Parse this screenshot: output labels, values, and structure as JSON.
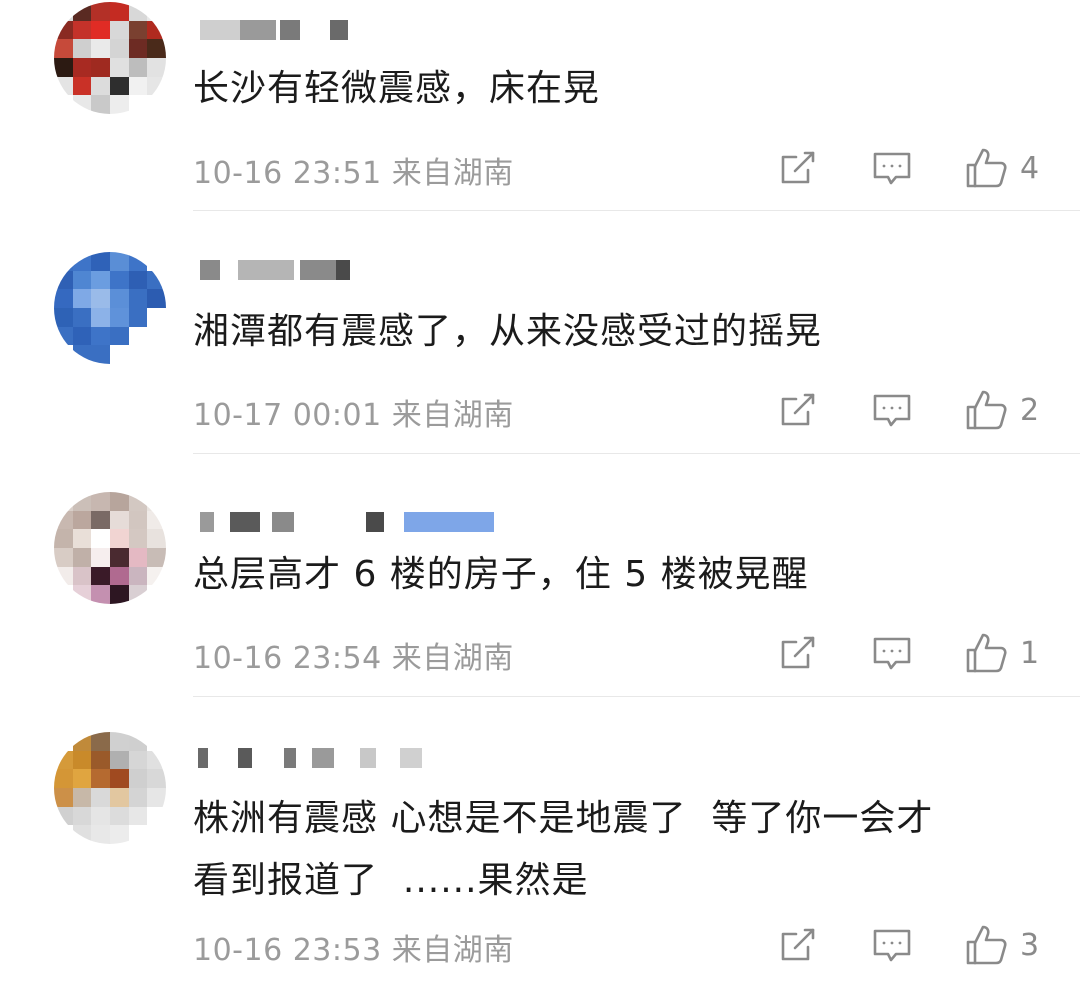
{
  "comments": [
    {
      "text_lines": [
        "长沙有轻微震感，床在晃"
      ],
      "time": "10-16 23:51",
      "location": "来自湖南",
      "likes": "4",
      "avatar_colors": [
        "#d9d9d9",
        "#5a2a22",
        "#b33027",
        "#c42b22",
        "#d8d8d8",
        "#e8e8e8",
        "#8a2a22",
        "#c4322a",
        "#e02c25",
        "#d8d8d8",
        "#7a4030",
        "#b02a1f",
        "#c64a3a",
        "#cfcfcf",
        "#eaeaea",
        "#d4d4d4",
        "#6d2b23",
        "#4a2a1a",
        "#2c1a12",
        "#a82a22",
        "#9f2a20",
        "#e0e0e0",
        "#bdbdbd",
        "#e2e2e2",
        "#e4e4e4",
        "#c93127",
        "#dcdcdc",
        "#2e2e2e",
        "#f1f1f1",
        "#e6e6e6",
        "#ffffff",
        "#e8e8e8",
        "#c9c9c9",
        "#ededed",
        "#ffffff",
        "#ffffff"
      ]
    },
    {
      "text_lines": [
        "湘潭都有震感了，从来没感受过的摇晃"
      ],
      "time": "10-17 00:01",
      "location": "来自湖南",
      "likes": "2",
      "avatar_colors": [
        "#3a6fc2",
        "#3e74c8",
        "#2f62b8",
        "#5a8ed6",
        "#3e74c8",
        "#ffffff",
        "#2f60b5",
        "#4f86d2",
        "#6b9de0",
        "#3e74c8",
        "#2e5fb4",
        "#3a6fc2",
        "#3569c0",
        "#7fa9e6",
        "#9abbe9",
        "#5b8fd8",
        "#3a6fc2",
        "#2c5cb1",
        "#2e62b6",
        "#3a6fc2",
        "#8cb2e8",
        "#5f92da",
        "#3a6fc2",
        "#ffffff",
        "#3a6fc2",
        "#2f62b8",
        "#3e74c8",
        "#3a6fc2",
        "#ffffff",
        "#ffffff",
        "#ffffff",
        "#3a6fc2",
        "#3a6fc2",
        "#ffffff",
        "#ffffff",
        "#ffffff"
      ]
    },
    {
      "text_lines": [
        "总层高才 6 楼的房子，住 5 楼被晃醒"
      ],
      "time": "10-16 23:54",
      "location": "来自湖南",
      "likes": "1",
      "avatar_colors": [
        "#d9cfc9",
        "#cbbfb8",
        "#c7b7b0",
        "#b7a59c",
        "#d3c8c2",
        "#e9e4e0",
        "#c8b8b0",
        "#bba79e",
        "#7a6a65",
        "#e6dcd8",
        "#d2c6c0",
        "#f0ebe8",
        "#c4b4ab",
        "#e9dfd8",
        "#ffffff",
        "#f1d4d2",
        "#d4c8c2",
        "#e8e2de",
        "#d8ccc5",
        "#c0b0a8",
        "#f6eeee",
        "#4a2a30",
        "#e4b9c3",
        "#c8bcb6",
        "#f2ecea",
        "#d9c3c8",
        "#3a1a28",
        "#b06a90",
        "#cab5bf",
        "#f5f1ef",
        "#ffffff",
        "#e6d0d8",
        "#c490b0",
        "#2d1622",
        "#d9cfd3",
        "#ffffff"
      ]
    },
    {
      "text_lines": [
        "株洲有震感 心想是不是地震了  等了你一会才",
        "看到报道了  ......果然是"
      ],
      "time": "10-16 23:53",
      "location": "来自湖南",
      "likes": "3",
      "avatar_colors": [
        "#ffffff",
        "#c08a3a",
        "#8a6a4a",
        "#d0d0d0",
        "#cfcfcf",
        "#ffffff",
        "#d59a3a",
        "#c98a2a",
        "#9a5a2a",
        "#b0b0b0",
        "#d6d6d6",
        "#e0e0e0",
        "#d49636",
        "#e0a540",
        "#b56a30",
        "#a04a20",
        "#cfcfcf",
        "#d8d8d8",
        "#cc9048",
        "#c7b8a8",
        "#d9d9d9",
        "#e2c7a0",
        "#d4d4d4",
        "#e6e6e6",
        "#d0d0d0",
        "#d8d8d8",
        "#e5e5e5",
        "#dcdcdc",
        "#e7e7e7",
        "#ffffff",
        "#ffffff",
        "#e0e0e0",
        "#e8e8e8",
        "#ececec",
        "#ffffff",
        "#ffffff"
      ]
    }
  ],
  "icons": {
    "share": "share-edit-icon",
    "reply": "comment-bubble-icon",
    "like": "thumbs-up-icon"
  },
  "colors": {
    "text": "#1b1b1b",
    "meta": "#9b9b9b",
    "divider": "#e8e8e8",
    "icon": "#8a8a8a"
  }
}
